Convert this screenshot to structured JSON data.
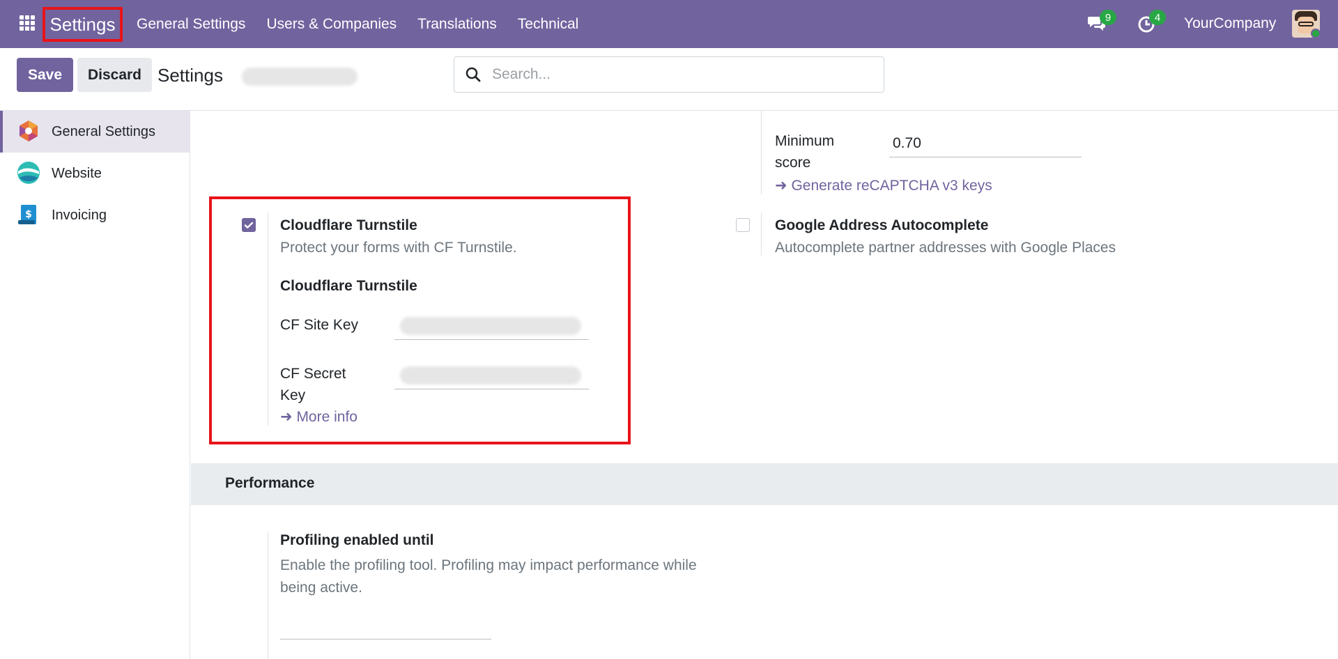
{
  "navbar": {
    "brand": "Settings",
    "menu": [
      "General Settings",
      "Users & Companies",
      "Translations",
      "Technical"
    ],
    "messages_badge": "9",
    "activities_badge": "4",
    "company": "YourCompany"
  },
  "control_panel": {
    "save_label": "Save",
    "discard_label": "Discard",
    "title": "Settings",
    "search_placeholder": "Search..."
  },
  "sidebar": {
    "items": [
      {
        "label": "General Settings",
        "active": true
      },
      {
        "label": "Website",
        "active": false
      },
      {
        "label": "Invoicing",
        "active": false
      }
    ]
  },
  "recaptcha": {
    "min_score_label": "Minimum score",
    "min_score_value": "0.70",
    "keys_link": "Generate reCAPTCHA v3 keys"
  },
  "turnstile": {
    "checked": true,
    "title": "Cloudflare Turnstile",
    "description": "Protect your forms with CF Turnstile.",
    "subtitle": "Cloudflare Turnstile",
    "site_key_label": "CF Site Key",
    "secret_key_label": "CF Secret Key",
    "more_info_link": "More info"
  },
  "google_address": {
    "checked": false,
    "title": "Google Address Autocomplete",
    "description": "Autocomplete partner addresses with Google Places"
  },
  "performance": {
    "section_title": "Performance",
    "profiling_title": "Profiling enabled until",
    "profiling_desc": "Enable the profiling tool. Profiling may impact performance while being active."
  },
  "colors": {
    "navbar": "#71639e",
    "accent": "#71639e",
    "highlight": "#e8141a",
    "badge": "#28a745"
  }
}
